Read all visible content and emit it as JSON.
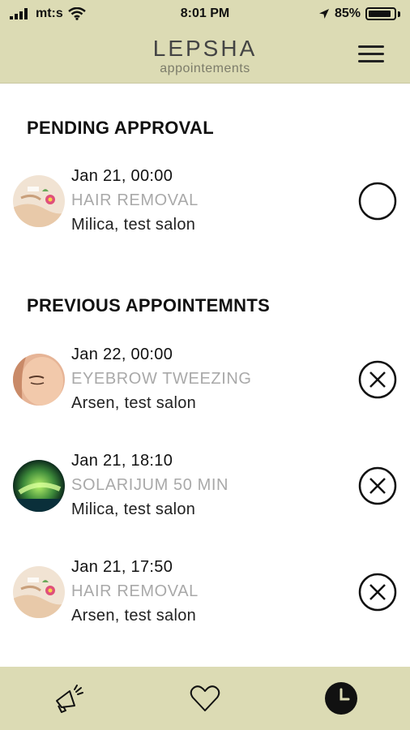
{
  "status": {
    "carrier": "mt:s",
    "time": "8:01 PM",
    "battery": "85%"
  },
  "header": {
    "logo": "LEPSHA",
    "subtitle": "appointements"
  },
  "pending": {
    "title": "PENDING APPROVAL",
    "items": [
      {
        "date": "Jan 21, 00:00",
        "service": "HAIR REMOVAL",
        "person": "Milica, test salon",
        "status": "pending"
      }
    ]
  },
  "previous": {
    "title": "PREVIOUS APPOINTEMNTS",
    "items": [
      {
        "date": "Jan 22, 00:00",
        "service": "EYEBROW TWEEZING",
        "person": "Arsen, test salon",
        "status": "cancelled"
      },
      {
        "date": "Jan 21, 18:10",
        "service": "SOLARIJUM 50 MIN",
        "person": "Milica, test salon",
        "status": "cancelled"
      },
      {
        "date": "Jan 21, 17:50",
        "service": "HAIR REMOVAL",
        "person": "Arsen, test salon",
        "status": "cancelled"
      }
    ]
  },
  "tabs": [
    {
      "icon": "megaphone-icon"
    },
    {
      "icon": "heart-icon"
    },
    {
      "icon": "clock-icon",
      "active": true
    }
  ],
  "colors": {
    "bar": "#dcdbb4",
    "muted_text": "#a9a9a9"
  }
}
